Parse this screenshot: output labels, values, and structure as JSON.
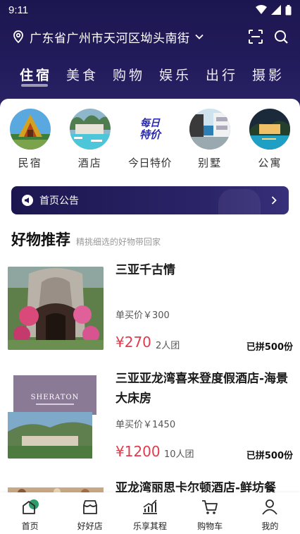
{
  "status_bar": {
    "time": "9:11"
  },
  "header": {
    "location": "广东省广州市天河区坳头南街",
    "tabs": [
      {
        "label": "住宿",
        "active": true
      },
      {
        "label": "美食",
        "active": false
      },
      {
        "label": "购物",
        "active": false
      },
      {
        "label": "娱乐",
        "active": false
      },
      {
        "label": "出行",
        "active": false
      },
      {
        "label": "摄影",
        "active": false
      }
    ]
  },
  "quick_icons": [
    {
      "label": "民宿"
    },
    {
      "label": "酒店"
    },
    {
      "label": "今日特价",
      "badge_line1": "每日",
      "badge_line2": "特价"
    },
    {
      "label": "别墅"
    },
    {
      "label": "公寓"
    }
  ],
  "announcement": {
    "label": "首页公告"
  },
  "section": {
    "title": "好物推荐",
    "subtitle": "精挑细选的好物带回家"
  },
  "products": [
    {
      "title": "三亚千古情",
      "single_price": "单买价￥300",
      "group_price": "¥270",
      "group_size": "2人团",
      "sold": "已拼500份"
    },
    {
      "title": "三亚亚龙湾喜来登度假酒店-海景大床房",
      "single_price": "单买价￥1450",
      "group_price": "¥1200",
      "group_size": "10人团",
      "sold": "已拼500份",
      "brand_text": "SHERATON"
    },
    {
      "title": "亚龙湾丽思卡尔顿酒店-鲜坊餐"
    }
  ],
  "bottom_nav": [
    {
      "label": "首页",
      "icon": "home-icon",
      "active": true
    },
    {
      "label": "好好店",
      "icon": "store-icon",
      "active": false
    },
    {
      "label": "乐享其程",
      "icon": "chart-icon",
      "active": false
    },
    {
      "label": "购物车",
      "icon": "cart-icon",
      "active": false
    },
    {
      "label": "我的",
      "icon": "user-icon",
      "active": false
    }
  ],
  "colors": {
    "header": "#1c1650",
    "price": "#e23a4d",
    "nav_accent": "#2e9b6b"
  }
}
